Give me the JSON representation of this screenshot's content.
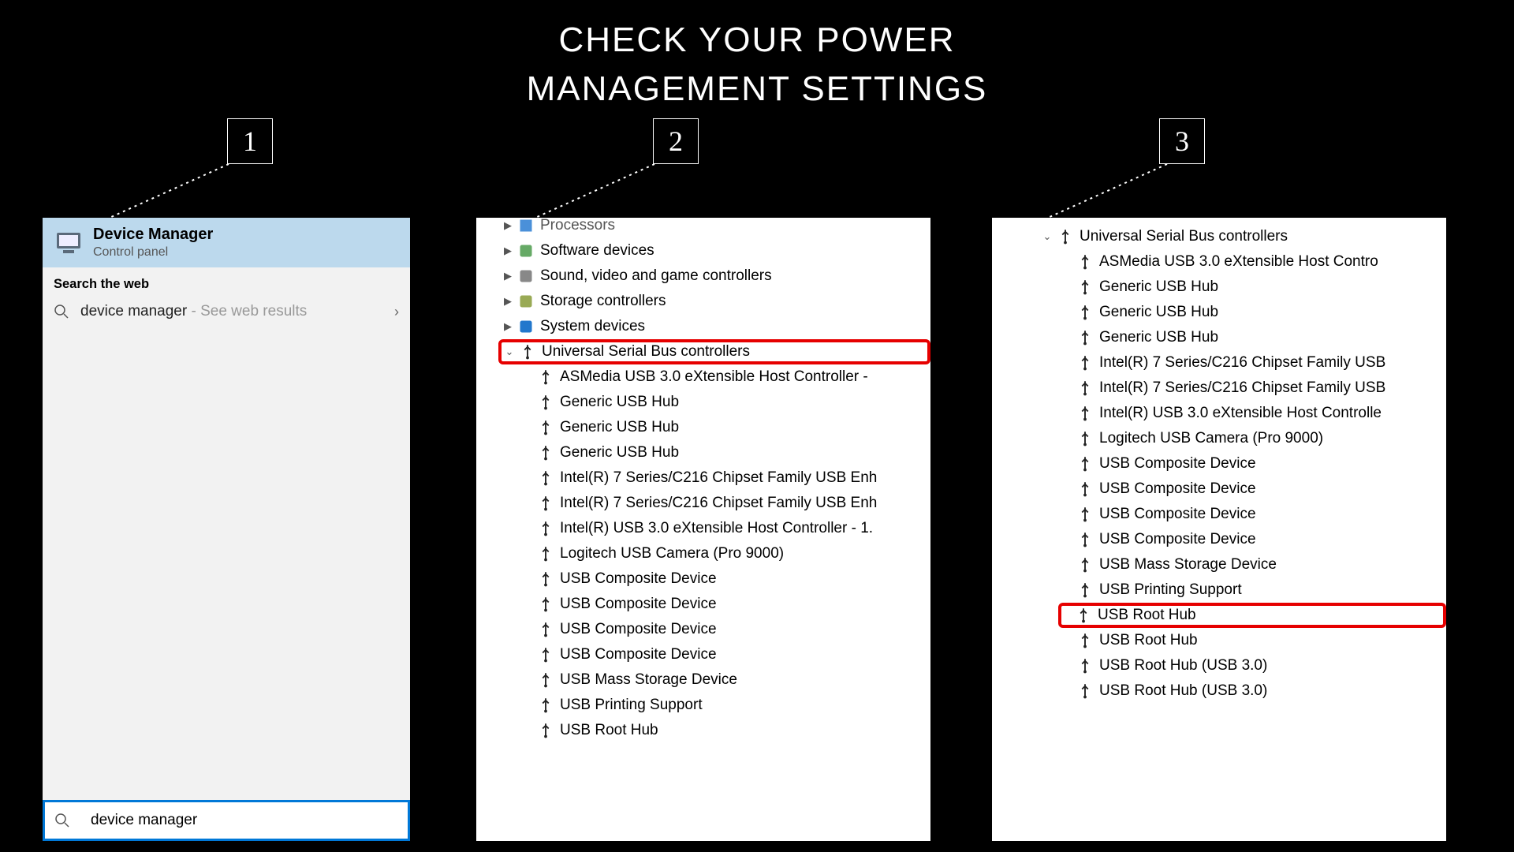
{
  "title": "CHECK YOUR POWER\nMANAGEMENT SETTINGS",
  "steps": [
    "1",
    "2",
    "3"
  ],
  "panel1": {
    "header_title": "Device Manager",
    "header_sub": "Control panel",
    "search_web_label": "Search the web",
    "web_result_text": "device manager",
    "web_result_suffix": " - See web results",
    "search_input_value": "device manager"
  },
  "panel2": {
    "cutoff_top": "Processors",
    "cat_items": [
      {
        "label": "Software devices",
        "icon": "gear"
      },
      {
        "label": "Sound, video and game controllers",
        "icon": "sound"
      },
      {
        "label": "Storage controllers",
        "icon": "storage"
      },
      {
        "label": "System devices",
        "icon": "system"
      }
    ],
    "usb_category": "Universal Serial Bus controllers",
    "usb_items": [
      "ASMedia USB 3.0 eXtensible Host Controller -",
      "Generic USB Hub",
      "Generic USB Hub",
      "Generic USB Hub",
      "Intel(R) 7 Series/C216 Chipset Family USB Enh",
      "Intel(R) 7 Series/C216 Chipset Family USB Enh",
      "Intel(R) USB 3.0 eXtensible Host Controller - 1.",
      "Logitech USB Camera (Pro 9000)",
      "USB Composite Device",
      "USB Composite Device",
      "USB Composite Device",
      "USB Composite Device",
      "USB Mass Storage Device",
      "USB Printing Support",
      "USB Root Hub"
    ]
  },
  "panel3": {
    "usb_category": "Universal Serial Bus controllers",
    "usb_items_before": [
      "ASMedia USB 3.0 eXtensible Host Contro",
      "Generic USB Hub",
      "Generic USB Hub",
      "Generic USB Hub",
      "Intel(R) 7 Series/C216 Chipset Family USB",
      "Intel(R) 7 Series/C216 Chipset Family USB",
      "Intel(R) USB 3.0 eXtensible Host Controlle",
      "Logitech USB Camera (Pro 9000)",
      "USB Composite Device",
      "USB Composite Device",
      "USB Composite Device",
      "USB Composite Device",
      "USB Mass Storage Device",
      "USB Printing Support"
    ],
    "usb_highlight": "USB Root Hub",
    "usb_items_after": [
      "USB Root Hub",
      "USB Root Hub (USB 3.0)",
      "USB Root Hub (USB 3.0)"
    ]
  }
}
